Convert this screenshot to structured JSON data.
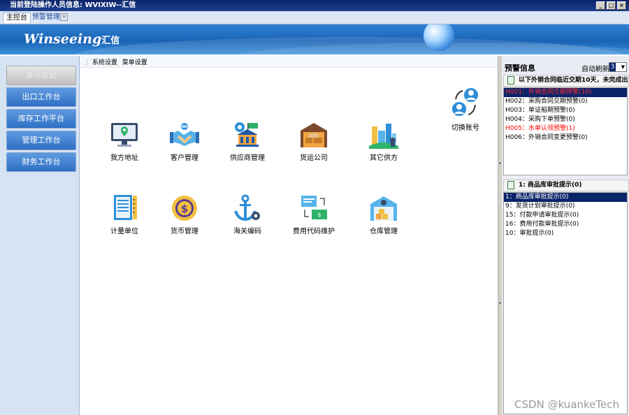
{
  "window": {
    "title": "当前登陆操作人员信息: WVIXIW--汇信",
    "controls": [
      "_",
      "□",
      "×"
    ]
  },
  "tabs": [
    {
      "label": "主控台"
    },
    {
      "label": "预警管理"
    }
  ],
  "banner": {
    "logo_text": "Winseeing",
    "logo_cn": "汇信"
  },
  "sidebar": {
    "items": [
      {
        "label": "基础数据"
      },
      {
        "label": "出口工作台"
      },
      {
        "label": "库存工作平台"
      },
      {
        "label": "管理工作台"
      },
      {
        "label": "财务工作台"
      }
    ]
  },
  "breadcrumb": {
    "items": [
      "系统设置",
      "菜单设置"
    ]
  },
  "modules": {
    "switch_account": "切换账号",
    "row1": [
      "我方地址",
      "客户管理",
      "供应商管理",
      "货运公司",
      "其它供方"
    ],
    "row2": [
      "计量单位",
      "货币管理",
      "海关编码",
      "费用代码维护",
      "仓库管理"
    ]
  },
  "warning_panel": {
    "title": "预警信息",
    "auto_refresh_label": "自动刷新",
    "auto_refresh_value": "3",
    "section1_title": "以下外销合同临近交期10天，未完成出",
    "section1_items": [
      {
        "text": "H001：外销合同交期预警(10)",
        "red": true,
        "selected": true
      },
      {
        "text": "H002：采购合同交期预警(0)",
        "red": false,
        "selected": false
      },
      {
        "text": "H003：单证船期预警(0)",
        "red": false,
        "selected": false
      },
      {
        "text": "H004：采购下单预警(0)",
        "red": false,
        "selected": false
      },
      {
        "text": "H005：水单认领预警(1)",
        "red": true,
        "selected": false
      },
      {
        "text": "H006：外销合同变更预警(0)",
        "red": false,
        "selected": false
      }
    ],
    "section2_title": "1: 商品库审批提示(0)",
    "section2_items": [
      {
        "text": "1：商品库审批提示(0)",
        "selected": true
      },
      {
        "text": "9：发货计划审批提示(0)",
        "selected": false
      },
      {
        "text": "15：付款申请审批提示(0)",
        "selected": false
      },
      {
        "text": "16：费用付款审批提示(0)",
        "selected": false
      },
      {
        "text": "10：审批提示(0)",
        "selected": false
      }
    ]
  },
  "watermark": "CSDN @kuankeTech",
  "colors": {
    "title_bar": "#0a246a",
    "banner": "#1a63b5",
    "nav_button": "#2f6fc4",
    "alert_red": "#ff0000",
    "selection": "#0a246a"
  }
}
